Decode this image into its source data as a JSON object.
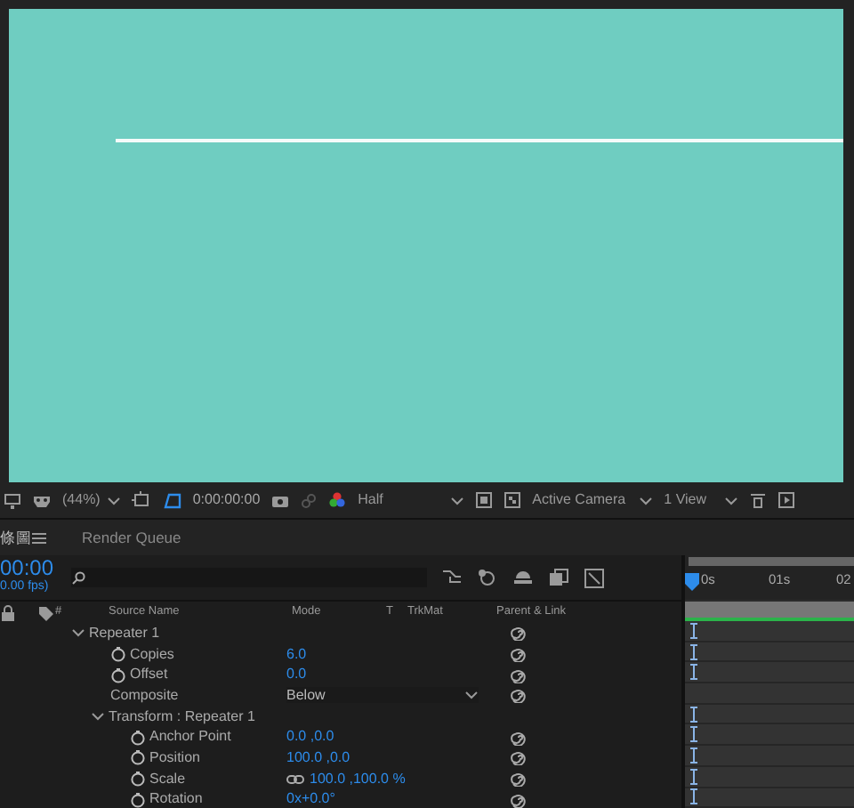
{
  "toolbar": {
    "zoom": "(44%)",
    "timecode": "0:00:00:00",
    "resolution": "Half",
    "camera": "Active Camera",
    "views": "1 View"
  },
  "tabs": [
    {
      "label": "條圖",
      "selected": true
    },
    {
      "label": "Render Queue",
      "selected": false
    }
  ],
  "timeline": {
    "time": "00:00",
    "fps": "0.00 fps)",
    "columns": [
      "#",
      "Source Name",
      "Mode",
      "T",
      "TrkMat",
      "Parent & Link"
    ],
    "ruler": [
      "0s",
      "01s",
      "02"
    ],
    "rows": [
      {
        "name": "Repeater 1",
        "kind": "group",
        "expanded": true,
        "children": [
          {
            "name": "Copies",
            "kind": "property",
            "value": "6.0"
          },
          {
            "name": "Offset",
            "kind": "property",
            "value": "0.0"
          },
          {
            "name": "Composite",
            "kind": "dropdown",
            "value": "Below"
          },
          {
            "name": "Transform : Repeater 1",
            "kind": "group",
            "expanded": true,
            "children": [
              {
                "name": "Anchor Point",
                "kind": "property",
                "value": "0.0 ,0.0"
              },
              {
                "name": "Position",
                "kind": "property",
                "value": "100.0 ,0.0"
              },
              {
                "name": "Scale",
                "kind": "property",
                "value": "100.0 ,100.0 %",
                "linked": true
              },
              {
                "name": "Rotation",
                "kind": "property",
                "value": "0x+0.0°"
              }
            ]
          }
        ]
      }
    ]
  }
}
